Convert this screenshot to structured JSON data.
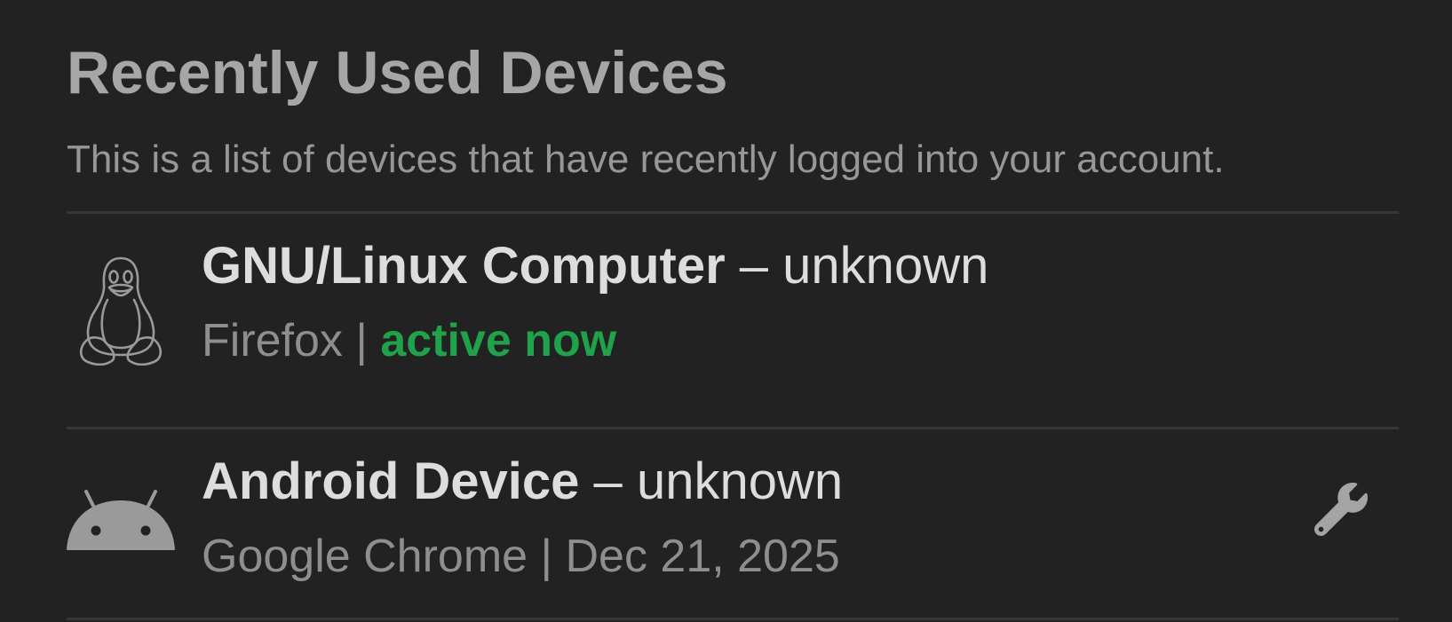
{
  "page": {
    "title": "Recently Used Devices",
    "description": "This is a list of devices that have recently logged into your account."
  },
  "devices": [
    {
      "name": "GNU/Linux Computer",
      "separator": " – ",
      "location": "unknown",
      "browser": "Firefox",
      "meta_separator": " | ",
      "status": "active now",
      "icon": "linux-tux-icon"
    },
    {
      "name": "Android Device",
      "separator": " – ",
      "location": "unknown",
      "browser": "Google Chrome",
      "meta_separator": " | ",
      "last_active": "Dec 21, 2025",
      "icon": "android-icon",
      "action_icon": "wrench-icon"
    }
  ],
  "colors": {
    "background": "#222222",
    "active_status": "#1fa24a",
    "divider": "#373737"
  }
}
